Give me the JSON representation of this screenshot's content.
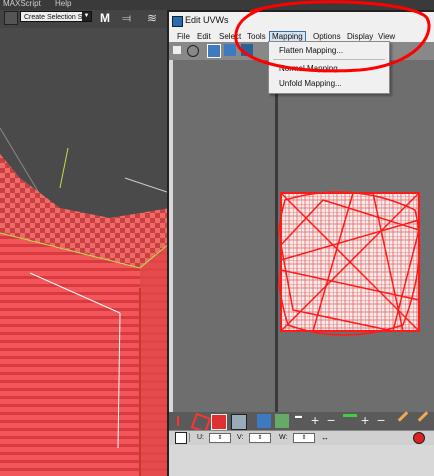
{
  "max_menu": {
    "items": [
      "MAXScript",
      "Help"
    ]
  },
  "max_toolbar": {
    "selection_set": "Create Selection Se"
  },
  "uvw_window": {
    "title": "Edit UVWs",
    "menu": [
      "File",
      "Edit",
      "Select",
      "Tools",
      "Mapping",
      "Options",
      "Display",
      "View"
    ],
    "active_menu": "Mapping"
  },
  "mapping_dropdown": {
    "items": [
      "Flatten Mapping...",
      "Normal Mapping...",
      "Unfold Mapping..."
    ]
  },
  "status": {
    "u_label": "U:",
    "v_label": "V:",
    "w_label": "W:"
  },
  "colors": {
    "uv_red": "#ff1a1a",
    "mesh_red": "#ef4d4d",
    "annotation_red": "#ff0000",
    "active_menu_border": "#3a6ea5"
  },
  "icons": [
    "selection-set-dropdown-icon",
    "mirror-icon",
    "layers-icon",
    "move-icon",
    "rotate-icon",
    "scale-icon",
    "freeform-icon",
    "snap-icon",
    "weld-icon",
    "lock-icon",
    "info-icon"
  ]
}
